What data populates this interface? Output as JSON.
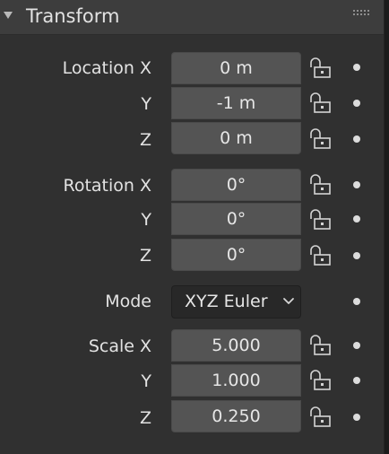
{
  "panel": {
    "title": "Transform",
    "collapse_icon": "triangle-down-icon",
    "grip_icon": "drag-grip-icon"
  },
  "location": {
    "x_label": "Location X",
    "y_label": "Y",
    "z_label": "Z",
    "x_value": "0 m",
    "y_value": "-1 m",
    "z_value": "0 m"
  },
  "rotation": {
    "x_label": "Rotation X",
    "y_label": "Y",
    "z_label": "Z",
    "x_value": "0°",
    "y_value": "0°",
    "z_value": "0°"
  },
  "mode": {
    "label": "Mode",
    "value": "XYZ Euler"
  },
  "scale": {
    "x_label": "Scale X",
    "y_label": "Y",
    "z_label": "Z",
    "x_value": "5.000",
    "y_value": "1.000",
    "z_value": "0.250"
  },
  "icons": {
    "lock": "unlocked-padlock-icon",
    "keyframe": "keyframe-dot-icon",
    "chevron": "chevron-down-icon"
  },
  "colors": {
    "panel_bg": "#303030",
    "header_bg": "#3d3d3d",
    "field_bg": "#545454",
    "dropdown_bg": "#282828",
    "text": "#e6e6e6"
  }
}
